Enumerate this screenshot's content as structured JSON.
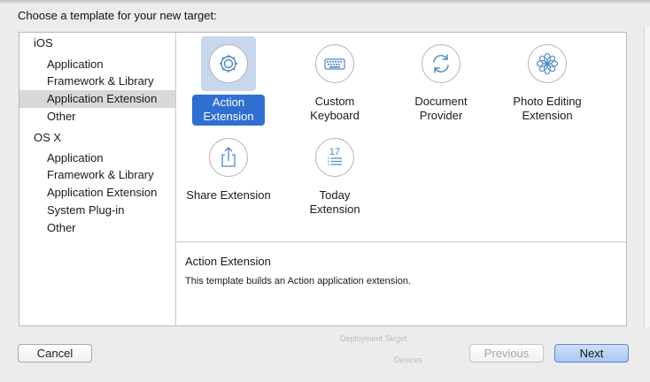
{
  "dialog": {
    "prompt": "Choose a template for your new target:"
  },
  "sidebar": {
    "groups": [
      {
        "label": "iOS",
        "items": [
          "Application",
          "Framework & Library",
          "Application Extension",
          "Other"
        ]
      },
      {
        "label": "OS X",
        "items": [
          "Application",
          "Framework & Library",
          "Application Extension",
          "System Plug-in",
          "Other"
        ]
      }
    ],
    "selected": "iOS / Application Extension"
  },
  "templates": [
    {
      "label": "Action\nExtension",
      "icon": "gear-icon",
      "selected": true
    },
    {
      "label": "Custom\nKeyboard",
      "icon": "keyboard-icon",
      "selected": false
    },
    {
      "label": "Document\nProvider",
      "icon": "refresh-arrows-icon",
      "selected": false
    },
    {
      "label": "Photo Editing\nExtension",
      "icon": "flower-icon",
      "selected": false
    },
    {
      "label": "Share Extension",
      "icon": "share-icon",
      "selected": false
    },
    {
      "label": "Today\nExtension",
      "icon": "calendar-list-icon",
      "selected": false
    }
  ],
  "today_icon_text": "17",
  "description": {
    "title": "Action Extension",
    "body": "This template builds an Action application extension."
  },
  "buttons": {
    "cancel": "Cancel",
    "previous": "Previous",
    "next": "Next"
  },
  "background_ghost": {
    "deployment_target": "Deployment Target",
    "devices": "Devices"
  },
  "colors": {
    "selection_blue": "#2f6fd2",
    "selection_light": "#c7d8ee",
    "sidebar_selected": "#d8d8d8"
  }
}
